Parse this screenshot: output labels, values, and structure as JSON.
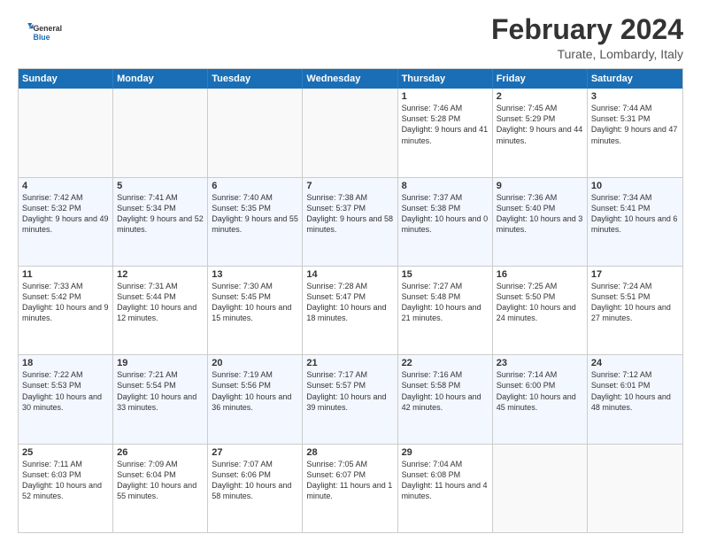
{
  "logo": {
    "line1": "General",
    "line2": "Blue"
  },
  "header": {
    "month_year": "February 2024",
    "location": "Turate, Lombardy, Italy"
  },
  "days_of_week": [
    "Sunday",
    "Monday",
    "Tuesday",
    "Wednesday",
    "Thursday",
    "Friday",
    "Saturday"
  ],
  "rows": [
    [
      {
        "day": "",
        "empty": true
      },
      {
        "day": "",
        "empty": true
      },
      {
        "day": "",
        "empty": true
      },
      {
        "day": "",
        "empty": true
      },
      {
        "day": "1",
        "sunrise": "7:46 AM",
        "sunset": "5:28 PM",
        "daylight": "9 hours and 41 minutes."
      },
      {
        "day": "2",
        "sunrise": "7:45 AM",
        "sunset": "5:29 PM",
        "daylight": "9 hours and 44 minutes."
      },
      {
        "day": "3",
        "sunrise": "7:44 AM",
        "sunset": "5:31 PM",
        "daylight": "9 hours and 47 minutes."
      }
    ],
    [
      {
        "day": "4",
        "sunrise": "7:42 AM",
        "sunset": "5:32 PM",
        "daylight": "9 hours and 49 minutes."
      },
      {
        "day": "5",
        "sunrise": "7:41 AM",
        "sunset": "5:34 PM",
        "daylight": "9 hours and 52 minutes."
      },
      {
        "day": "6",
        "sunrise": "7:40 AM",
        "sunset": "5:35 PM",
        "daylight": "9 hours and 55 minutes."
      },
      {
        "day": "7",
        "sunrise": "7:38 AM",
        "sunset": "5:37 PM",
        "daylight": "9 hours and 58 minutes."
      },
      {
        "day": "8",
        "sunrise": "7:37 AM",
        "sunset": "5:38 PM",
        "daylight": "10 hours and 0 minutes."
      },
      {
        "day": "9",
        "sunrise": "7:36 AM",
        "sunset": "5:40 PM",
        "daylight": "10 hours and 3 minutes."
      },
      {
        "day": "10",
        "sunrise": "7:34 AM",
        "sunset": "5:41 PM",
        "daylight": "10 hours and 6 minutes."
      }
    ],
    [
      {
        "day": "11",
        "sunrise": "7:33 AM",
        "sunset": "5:42 PM",
        "daylight": "10 hours and 9 minutes."
      },
      {
        "day": "12",
        "sunrise": "7:31 AM",
        "sunset": "5:44 PM",
        "daylight": "10 hours and 12 minutes."
      },
      {
        "day": "13",
        "sunrise": "7:30 AM",
        "sunset": "5:45 PM",
        "daylight": "10 hours and 15 minutes."
      },
      {
        "day": "14",
        "sunrise": "7:28 AM",
        "sunset": "5:47 PM",
        "daylight": "10 hours and 18 minutes."
      },
      {
        "day": "15",
        "sunrise": "7:27 AM",
        "sunset": "5:48 PM",
        "daylight": "10 hours and 21 minutes."
      },
      {
        "day": "16",
        "sunrise": "7:25 AM",
        "sunset": "5:50 PM",
        "daylight": "10 hours and 24 minutes."
      },
      {
        "day": "17",
        "sunrise": "7:24 AM",
        "sunset": "5:51 PM",
        "daylight": "10 hours and 27 minutes."
      }
    ],
    [
      {
        "day": "18",
        "sunrise": "7:22 AM",
        "sunset": "5:53 PM",
        "daylight": "10 hours and 30 minutes."
      },
      {
        "day": "19",
        "sunrise": "7:21 AM",
        "sunset": "5:54 PM",
        "daylight": "10 hours and 33 minutes."
      },
      {
        "day": "20",
        "sunrise": "7:19 AM",
        "sunset": "5:56 PM",
        "daylight": "10 hours and 36 minutes."
      },
      {
        "day": "21",
        "sunrise": "7:17 AM",
        "sunset": "5:57 PM",
        "daylight": "10 hours and 39 minutes."
      },
      {
        "day": "22",
        "sunrise": "7:16 AM",
        "sunset": "5:58 PM",
        "daylight": "10 hours and 42 minutes."
      },
      {
        "day": "23",
        "sunrise": "7:14 AM",
        "sunset": "6:00 PM",
        "daylight": "10 hours and 45 minutes."
      },
      {
        "day": "24",
        "sunrise": "7:12 AM",
        "sunset": "6:01 PM",
        "daylight": "10 hours and 48 minutes."
      }
    ],
    [
      {
        "day": "25",
        "sunrise": "7:11 AM",
        "sunset": "6:03 PM",
        "daylight": "10 hours and 52 minutes."
      },
      {
        "day": "26",
        "sunrise": "7:09 AM",
        "sunset": "6:04 PM",
        "daylight": "10 hours and 55 minutes."
      },
      {
        "day": "27",
        "sunrise": "7:07 AM",
        "sunset": "6:06 PM",
        "daylight": "10 hours and 58 minutes."
      },
      {
        "day": "28",
        "sunrise": "7:05 AM",
        "sunset": "6:07 PM",
        "daylight": "11 hours and 1 minute."
      },
      {
        "day": "29",
        "sunrise": "7:04 AM",
        "sunset": "6:08 PM",
        "daylight": "11 hours and 4 minutes."
      },
      {
        "day": "",
        "empty": true
      },
      {
        "day": "",
        "empty": true
      }
    ]
  ]
}
